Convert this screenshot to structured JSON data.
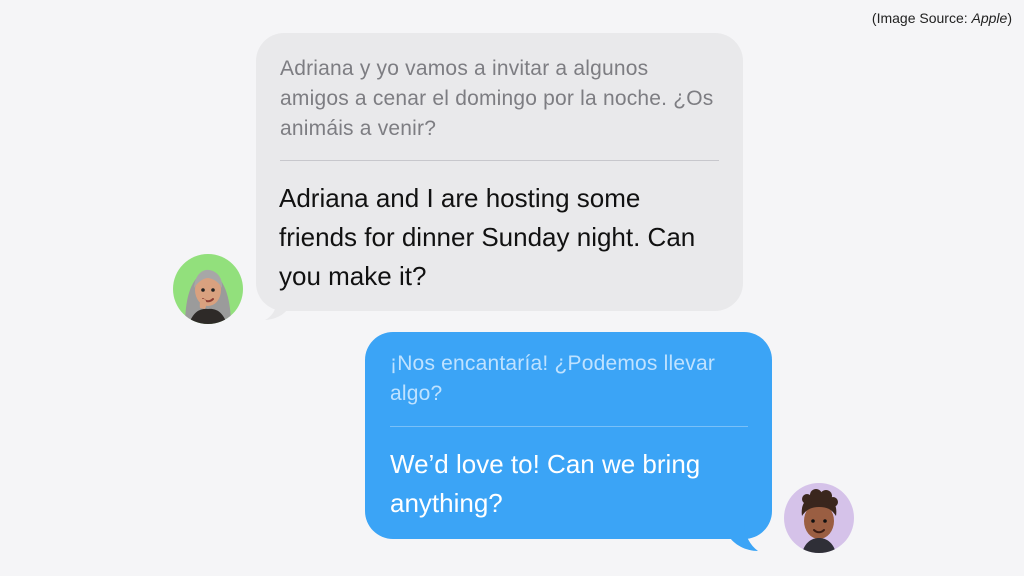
{
  "source_credit": {
    "prefix": "(Image Source: ",
    "name": "Apple",
    "suffix": ")"
  },
  "conversation": {
    "incoming": {
      "translated_text": "Adriana y yo vamos a invitar a algunos amigos a cenar el domingo por la noche. ¿Os animáis a venir?",
      "original_text": "Adriana and I are hosting some friends for dinner Sunday night. Can you make it?",
      "avatar_icon": "memoji-woman-gray-hair"
    },
    "outgoing": {
      "translated_text": "¡Nos encantaría! ¿Podemos llevar algo?",
      "original_text": "We’d love to! Can we bring anything?",
      "avatar_icon": "memoji-man-curly-hair"
    }
  },
  "colors": {
    "background": "#f5f5f7",
    "incoming_bubble": "#e9e9eb",
    "outgoing_bubble": "#3ba4f6",
    "incoming_avatar_bg": "#92e07c",
    "outgoing_avatar_bg": "#d5c2e9"
  }
}
